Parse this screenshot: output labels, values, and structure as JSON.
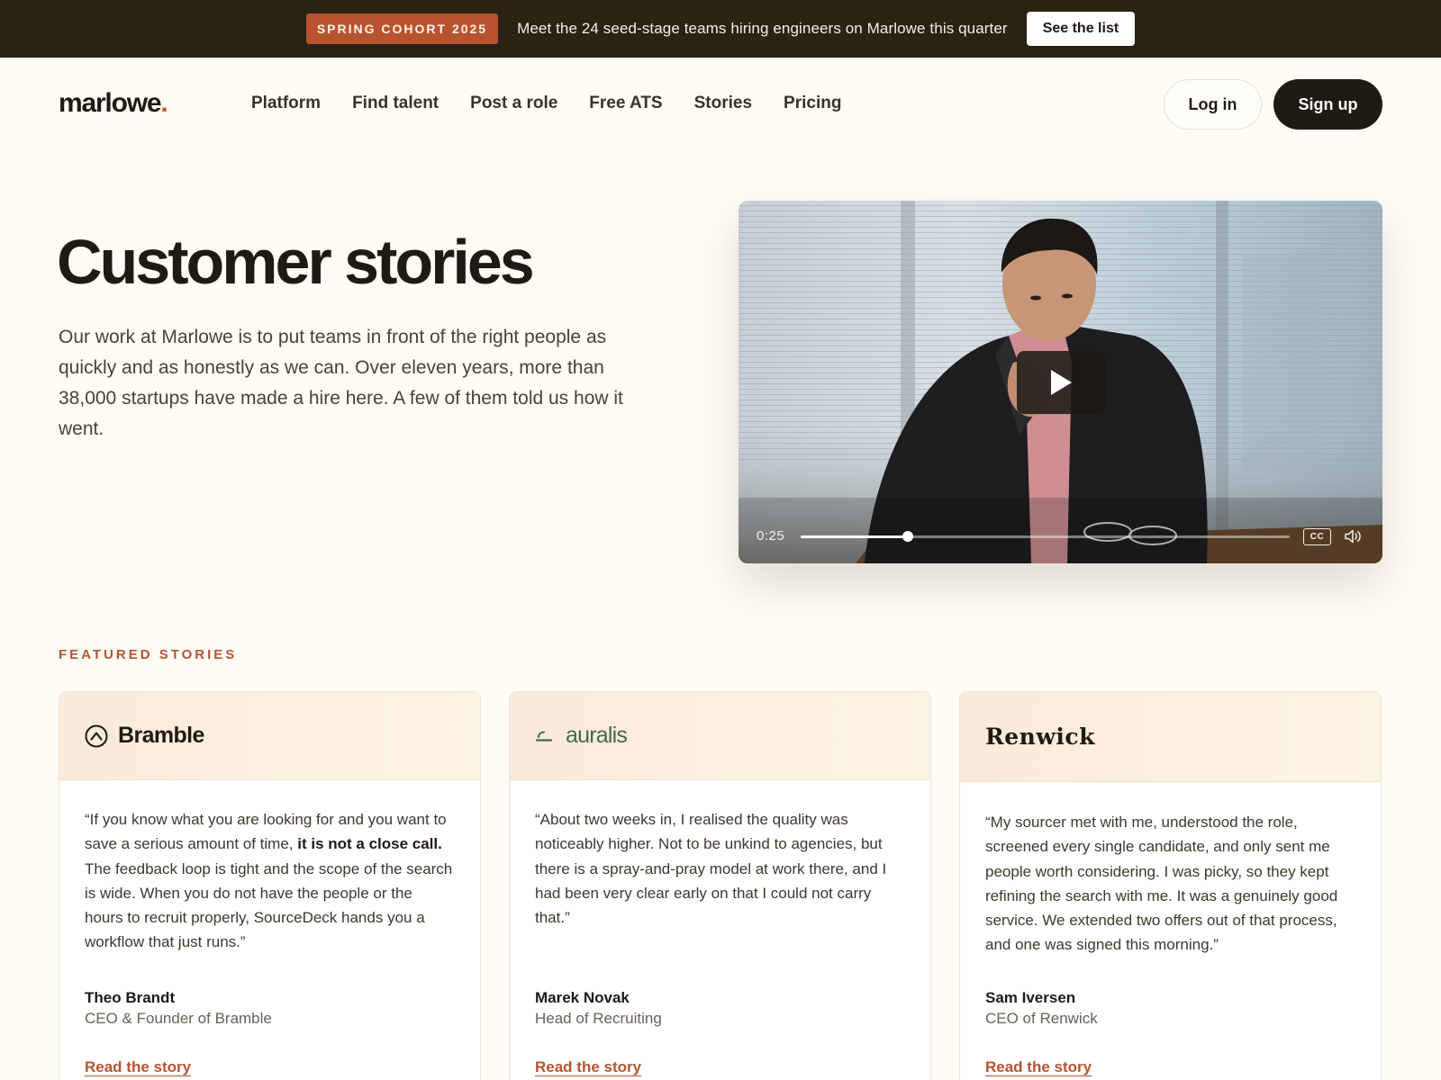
{
  "announcement": {
    "badge": "SPRING COHORT 2025",
    "text": "Meet the 24 seed-stage teams hiring engineers on Marlowe this quarter",
    "cta": "See the list"
  },
  "header": {
    "logo": "marlowe",
    "logo_dot": ".",
    "nav": [
      "Platform",
      "Find talent",
      "Post a role",
      "Free ATS",
      "Stories",
      "Pricing"
    ],
    "login": "Log in",
    "signup": "Sign up"
  },
  "hero": {
    "title": "Customer stories",
    "intro": "Our work at Marlowe is to put teams in front of the right people as quickly and as honestly as we can. Over eleven years, more than 38,000 startups have made a hire here. A few of them told us how it went."
  },
  "video": {
    "time": "0:25",
    "progress": 0.22,
    "cc_label": "CC"
  },
  "featured": {
    "label": "FEATURED STORIES",
    "cards": [
      {
        "brand": "Bramble",
        "brand_color": "#1f1a12",
        "icon": "bramble-logo-icon",
        "quote_pre": "“If you know what you are looking for and you want to save a serious amount of time, ",
        "quote_bold": "it is not a close call.",
        "quote_post": " The feedback loop is tight and the scope of the search is wide. When you do not have the people or the hours to recruit properly, SourceDeck hands you a workflow that just runs.”",
        "name": "Theo Brandt",
        "role": "CEO & Founder of Bramble",
        "link": "Read the story"
      },
      {
        "brand": "auralis",
        "brand_color": "#3f6a4a",
        "icon": "auralis-logo-icon",
        "quote_pre": "“About two weeks in, I realised the quality was noticeably higher. Not to be unkind to agencies, but there is a spray-and-pray model at work there, and I had been very clear early on that I could not carry that.”",
        "quote_bold": "",
        "quote_post": "",
        "name": "Marek Novak",
        "role": "Head of Recruiting",
        "link": "Read the story"
      },
      {
        "brand": "Renwick",
        "brand_color": "#1f1a12",
        "icon": "",
        "quote_pre": "“My sourcer met with me, understood the role, screened every single candidate, and only sent me people worth considering. I was picky, so they kept refining the search with me. It was a genuinely good service. We extended two offers out of that process, and one was signed this morning.”",
        "quote_bold": "",
        "quote_post": "",
        "name": "Sam Iversen",
        "role": "CEO of Renwick",
        "link": "Read the story"
      }
    ]
  },
  "colors": {
    "accent": "#b9532f",
    "dark": "#1f1a12",
    "background": "#fffcf6"
  }
}
